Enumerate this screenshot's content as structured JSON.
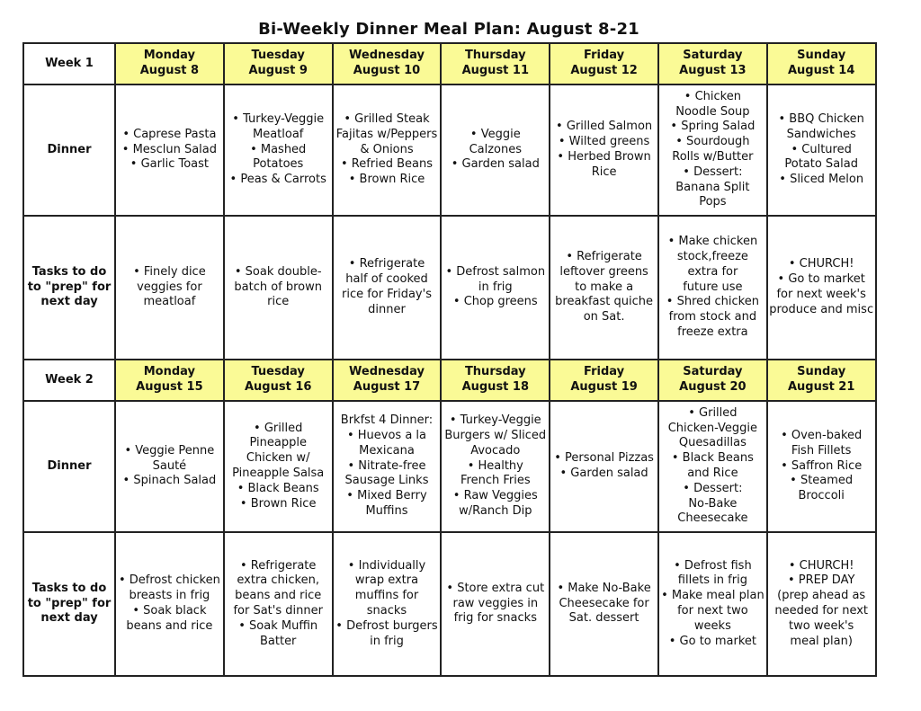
{
  "title": "Bi-Weekly Dinner Meal Plan: August 8-21",
  "colors": {
    "header_fill": "#fafa96",
    "border": "#222222"
  },
  "weeks": [
    {
      "label": "Week 1",
      "days": [
        {
          "day": "Monday",
          "date": "August 8"
        },
        {
          "day": "Tuesday",
          "date": "August 9"
        },
        {
          "day": "Wednesday",
          "date": "August 10"
        },
        {
          "day": "Thursday",
          "date": "August 11"
        },
        {
          "day": "Friday",
          "date": "August 12"
        },
        {
          "day": "Saturday",
          "date": "August 13"
        },
        {
          "day": "Sunday",
          "date": "August 14"
        }
      ],
      "dinner_label": "Dinner",
      "tasks_label": [
        "Tasks to do",
        "to \"prep\" for",
        "next day"
      ],
      "dinner": [
        [
          "• Caprese Pasta",
          "• Mesclun Salad",
          "• Garlic Toast"
        ],
        [
          "• Turkey-Veggie",
          "Meatloaf",
          "• Mashed",
          "Potatoes",
          "• Peas & Carrots"
        ],
        [
          "• Grilled Steak",
          "Fajitas w/Peppers",
          "& Onions",
          "• Refried Beans",
          "• Brown Rice"
        ],
        [
          "• Veggie",
          "Calzones",
          "• Garden salad"
        ],
        [
          "• Grilled Salmon",
          "• Wilted greens",
          "• Herbed Brown",
          "Rice"
        ],
        [
          "• Chicken",
          "Noodle Soup",
          "• Spring Salad",
          "• Sourdough",
          "Rolls w/Butter",
          "• Dessert:",
          "Banana Split",
          "Pops"
        ],
        [
          "• BBQ Chicken",
          "Sandwiches",
          "• Cultured",
          "Potato Salad",
          "• Sliced Melon"
        ]
      ],
      "tasks": [
        [
          "• Finely dice",
          "veggies for",
          "meatloaf"
        ],
        [
          "• Soak double-",
          "batch of brown",
          "rice"
        ],
        [
          "• Refrigerate",
          "half of cooked",
          "rice for Friday's",
          "dinner"
        ],
        [
          "• Defrost salmon",
          "in frig",
          "• Chop greens"
        ],
        [
          "• Refrigerate",
          "leftover greens",
          "to make a",
          "breakfast quiche",
          "on Sat."
        ],
        [
          "• Make chicken",
          "stock,freeze",
          "extra for",
          "future use",
          "• Shred chicken",
          "from stock and",
          "freeze extra"
        ],
        [
          "• CHURCH!",
          "• Go to market",
          "for next week's",
          "produce and misc"
        ]
      ]
    },
    {
      "label": "Week 2",
      "days": [
        {
          "day": "Monday",
          "date": "August 15"
        },
        {
          "day": "Tuesday",
          "date": "August 16"
        },
        {
          "day": "Wednesday",
          "date": "August 17"
        },
        {
          "day": "Thursday",
          "date": "August 18"
        },
        {
          "day": "Friday",
          "date": "August 19"
        },
        {
          "day": "Saturday",
          "date": "August 20"
        },
        {
          "day": "Sunday",
          "date": "August 21"
        }
      ],
      "dinner_label": "Dinner",
      "tasks_label": [
        "Tasks to do",
        "to \"prep\" for",
        "next day"
      ],
      "dinner": [
        [
          "• Veggie Penne",
          "Sauté",
          "• Spinach Salad"
        ],
        [
          "• Grilled",
          "Pineapple",
          "Chicken w/",
          "Pineapple Salsa",
          "• Black Beans",
          "• Brown Rice"
        ],
        [
          "Brkfst 4 Dinner:",
          "• Huevos a la",
          "Mexicana",
          "• Nitrate-free",
          "Sausage Links",
          "• Mixed Berry",
          "Muffins"
        ],
        [
          "• Turkey-Veggie",
          "Burgers w/ Sliced",
          "Avocado",
          "• Healthy",
          "French Fries",
          "• Raw Veggies",
          "w/Ranch Dip"
        ],
        [
          "• Personal Pizzas",
          "• Garden salad"
        ],
        [
          "• Grilled",
          "Chicken-Veggie",
          "Quesadillas",
          "• Black Beans",
          "and Rice",
          "• Dessert:",
          "No-Bake",
          "Cheesecake"
        ],
        [
          "• Oven-baked",
          "Fish Fillets",
          "• Saffron Rice",
          "• Steamed",
          "Broccoli"
        ]
      ],
      "tasks": [
        [
          "• Defrost chicken",
          "breasts in frig",
          "• Soak black",
          "beans and rice"
        ],
        [
          "• Refrigerate",
          "extra chicken,",
          "beans and rice",
          "for Sat's dinner",
          "• Soak Muffin",
          "Batter"
        ],
        [
          "• Individually",
          "wrap extra",
          "muffins for",
          "snacks",
          "• Defrost burgers",
          "in frig"
        ],
        [
          "• Store extra cut",
          "raw veggies in",
          "frig for snacks"
        ],
        [
          "• Make No-Bake",
          "Cheesecake for",
          "Sat. dessert"
        ],
        [
          "• Defrost fish",
          "fillets in frig",
          "• Make meal plan",
          "for next two",
          "weeks",
          "• Go to market"
        ],
        [
          "• CHURCH!",
          "• PREP DAY",
          "(prep ahead as",
          "needed for next",
          "two week's",
          "meal plan)"
        ]
      ]
    }
  ]
}
